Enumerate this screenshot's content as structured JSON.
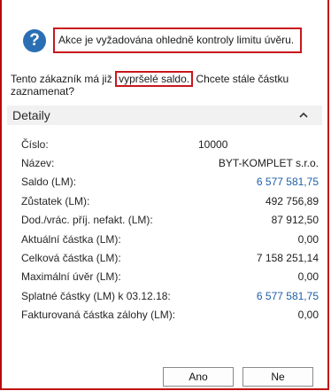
{
  "dialog": {
    "message": "Akce je vyžadována ohledně kontroly limitu úvěru.",
    "subtext_before": "Tento zákazník má již ",
    "subtext_highlight": "vypršelé saldo.",
    "subtext_after": " Chcete stále částku zaznamenat?",
    "details_title": "Detaily",
    "rows": [
      {
        "label": "Číslo:",
        "value": "10000"
      },
      {
        "label": "Název:",
        "value": "BYT-KOMPLET s.r.o."
      },
      {
        "label": "Saldo (LM):",
        "value": "6 577 581,75"
      },
      {
        "label": "Zůstatek (LM):",
        "value": "492 756,89"
      },
      {
        "label": "Dod./vrác. příj. nefakt. (LM):",
        "value": "87 912,50"
      },
      {
        "label": "Aktuální částka (LM):",
        "value": "0,00"
      },
      {
        "label": "Celková částka (LM):",
        "value": "7 158 251,14"
      },
      {
        "label": "Maximální úvěr (LM):",
        "value": "0,00"
      },
      {
        "label": "Splatné částky (LM) k 03.12.18:",
        "value": "6 577 581,75"
      },
      {
        "label": "Fakturovaná částka zálohy (LM):",
        "value": "0,00"
      }
    ],
    "yes_label": "Ano",
    "no_label": "Ne"
  },
  "icons": {
    "question": "question-icon",
    "chevron": "chevron-up-icon"
  },
  "colors": {
    "accent_blue": "#2a6fb4",
    "link_blue": "#1d5ea8",
    "annotation_red": "#c8171d"
  }
}
